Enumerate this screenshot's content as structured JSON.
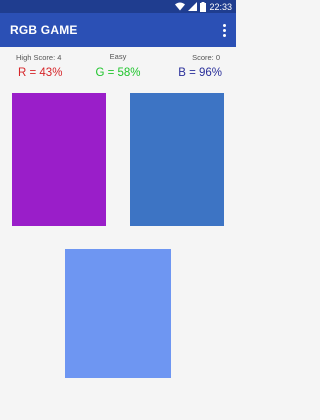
{
  "status_bar": {
    "time": "22:33",
    "icons": [
      "wifi-icon",
      "signal-icon",
      "battery-icon"
    ]
  },
  "app_bar": {
    "title": "RGB GAME",
    "menu_icon": "more-vert-icon"
  },
  "game": {
    "high_score": "High Score: 4",
    "difficulty": "Easy",
    "score": "Score: 0",
    "r_label": "R = 43%",
    "g_label": "G = 58%",
    "b_label": "B = 96%"
  },
  "swatches": [
    {
      "color": "#9a1ec9"
    },
    {
      "color": "#3d74c4"
    },
    {
      "color": "#6e96f2"
    }
  ],
  "colors": {
    "status_bar": "#1f3d8f",
    "app_bar": "#2b50b5",
    "r_text": "#d6262a",
    "g_text": "#20c52d",
    "b_text": "#2a2f9a"
  }
}
